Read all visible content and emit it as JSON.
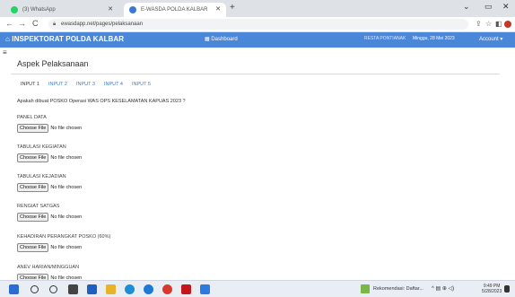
{
  "browser": {
    "tabs": [
      {
        "title": "(3) WhatsApp",
        "active": false,
        "color": "#25d366"
      },
      {
        "title": "E-WASDA POLDA KALBAR",
        "active": true,
        "color": "#3b78d6"
      }
    ],
    "new_tab_label": "+",
    "window_controls": {
      "minimize": "⌄",
      "restore": "▭",
      "close": "✕"
    },
    "url": "ewasdapp.net/pages/pelaksanaan",
    "nav": {
      "back": "←",
      "forward": "→",
      "reload": "C"
    },
    "right_icons": {
      "share": "⇪",
      "star": "☆",
      "sidebar": "◧"
    }
  },
  "navbar": {
    "brand": "INSPEKTORAT POLDA KALBAR",
    "brand_icon": "home-icon",
    "dashboard": "Dashboard",
    "resta": "RESTA PONTIANAK",
    "date": "Minggu, 28 Mei 2023",
    "account": "Account ▾",
    "color": "#4a87d9"
  },
  "page": {
    "title": "Aspek Pelaksanaan",
    "tabs": [
      "INPUT 1",
      "INPUT 2",
      "INPUT 3",
      "INPUT 4",
      "INPUT 5"
    ],
    "question": "Apakah dibuat POSKO Operasi WAS OPS KESELAMATAN KAPUAS 2023 ?",
    "file_button": "Choose File",
    "no_file": "No file chosen",
    "fields": [
      {
        "label": "PANEL DATA"
      },
      {
        "label": "TABULASI KEGIATAN"
      },
      {
        "label": "TABULASI KEJADIAN"
      },
      {
        "label": "RENGIAT SATGAS"
      },
      {
        "label": "KEHADIRAN PERANGKAT POSKO (60%)"
      },
      {
        "label": "ANEV HARIAN/MINGGUAN"
      }
    ]
  },
  "taskbar": {
    "notification": "Rekomendasi: Daftar...",
    "tray": "^ ▤ ⊕ ◁)",
    "time": "9:49 PM",
    "date": "5/28/2023"
  }
}
